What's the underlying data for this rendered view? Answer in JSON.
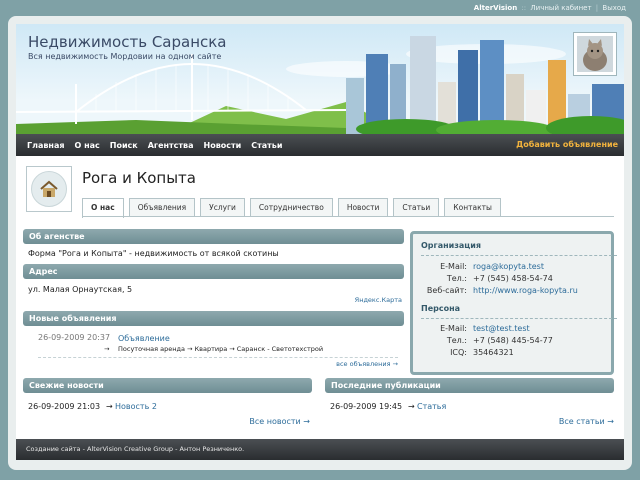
{
  "topbar": {
    "brand": "AlterVision",
    "sep": "::",
    "cabinet": "Личный кабинет",
    "divider": "|",
    "logout": "Выход"
  },
  "header": {
    "title": "Недвижимость Саранска",
    "subtitle": "Вся недвижимость Мордовии на одном сайте"
  },
  "nav": {
    "items": [
      "Главная",
      "О нас",
      "Поиск",
      "Агентства",
      "Новости",
      "Статьи"
    ],
    "add_label": "Добавить объявление"
  },
  "agency": {
    "name": "Рога и Копыта",
    "tabs": [
      "О нас",
      "Объявления",
      "Услуги",
      "Сотрудничество",
      "Новости",
      "Статьи",
      "Контакты"
    ],
    "active_tab": "О нас"
  },
  "about": {
    "header": "Об агенстве",
    "text": "Форма \"Рога и Копыта\" - недвижимость от всякой скотины"
  },
  "address": {
    "header": "Адрес",
    "text": "ул. Малая Орнаутская, 5",
    "map_link": "Яндекс.Карта"
  },
  "listings": {
    "header": "Новые объявления",
    "item": {
      "date": "26-09-2009 20:37",
      "title": "Объявление",
      "arrow": "→",
      "path": "Посуточная аренда → Квартира → Саранск - Светотехстрой"
    },
    "all_link": "все объявления →"
  },
  "news": {
    "header": "Свежие новости",
    "date": "26-09-2009 21:03",
    "arrow": "→",
    "title": "Новость 2",
    "all_link": "Все новости →"
  },
  "publications": {
    "header": "Последние публикации",
    "date": "26-09-2009 19:45",
    "arrow": "→",
    "title": "Статья",
    "all_link": "Все статьи →"
  },
  "organization": {
    "header": "Организация",
    "email_label": "E-Mail:",
    "email": "roga@kopyta.test",
    "phone_label": "Тел.:",
    "phone": "+7 (545) 458-54-74",
    "site_label": "Веб-сайт:",
    "site": "http://www.roga-kopyta.ru"
  },
  "person": {
    "header": "Персона",
    "email_label": "E-Mail:",
    "email": "test@test.test",
    "phone_label": "Тел.:",
    "phone": "+7 (548) 445-54-77",
    "icq_label": "ICQ:",
    "icq": "35464321"
  },
  "footer": {
    "text": "Создание сайта - AlterVision Creative Group - Антон Резниченко."
  }
}
